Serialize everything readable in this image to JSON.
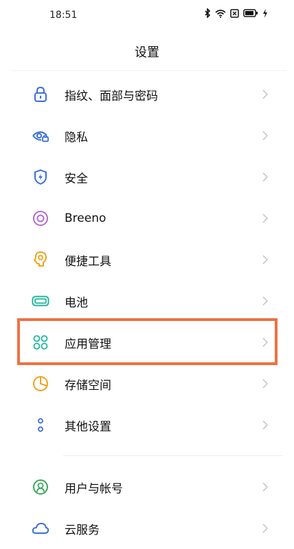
{
  "status_bar": {
    "time": "18:51",
    "icons": [
      "bluetooth-icon",
      "wifi-icon",
      "sim-icon",
      "battery-icon",
      "charging-icon"
    ]
  },
  "page": {
    "title": "设置"
  },
  "menu_items": [
    {
      "label": "指纹、面部与密码",
      "icon": "lock-icon",
      "color": "#3b6fd6"
    },
    {
      "label": "隐私",
      "icon": "privacy-eye-icon",
      "color": "#3b6fd6"
    },
    {
      "label": "安全",
      "icon": "shield-icon",
      "color": "#3b6fd6"
    },
    {
      "label": "Breeno",
      "icon": "breeno-icon",
      "color": "#b36bd1"
    },
    {
      "label": "便捷工具",
      "icon": "tools-bulb-icon",
      "color": "#f0a21a"
    },
    {
      "label": "电池",
      "icon": "battery-menu-icon",
      "color": "#1fb69f"
    },
    {
      "label": "应用管理",
      "icon": "apps-grid-icon",
      "color": "#1fb69f",
      "highlighted": true
    },
    {
      "label": "存储空间",
      "icon": "storage-pie-icon",
      "color": "#f0a21a"
    },
    {
      "label": "其他设置",
      "icon": "more-dots-icon",
      "color": "#3b6fd6"
    },
    {
      "label": "用户与帐号",
      "icon": "user-account-icon",
      "color": "#3aa85a"
    },
    {
      "label": "云服务",
      "icon": "cloud-icon",
      "color": "#3b6fd6"
    }
  ],
  "colors": {
    "highlight_border": "#ef7040",
    "chevron": "#c4c4c4"
  }
}
